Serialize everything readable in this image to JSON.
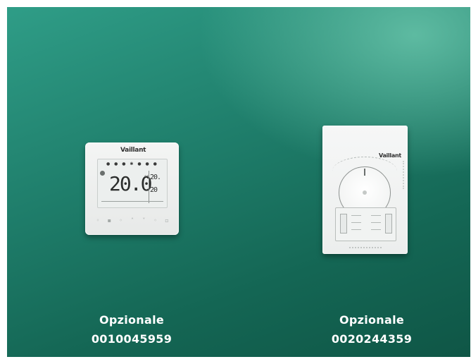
{
  "products": [
    {
      "type": "digital-thermostat",
      "brand": "Vaillant",
      "display": {
        "main_temp": "20.0",
        "side_top": "20.",
        "side_bottom": "20"
      },
      "caption_label": "Opzionale",
      "code": "0010045959"
    },
    {
      "type": "analog-thermostat",
      "brand": "Vaillant",
      "caption_label": "Opzionale",
      "code": "0020244359"
    }
  ],
  "colors": {
    "background_dark": "#146654",
    "background_light": "#68c4aa",
    "caption_text": "#ffffff"
  }
}
